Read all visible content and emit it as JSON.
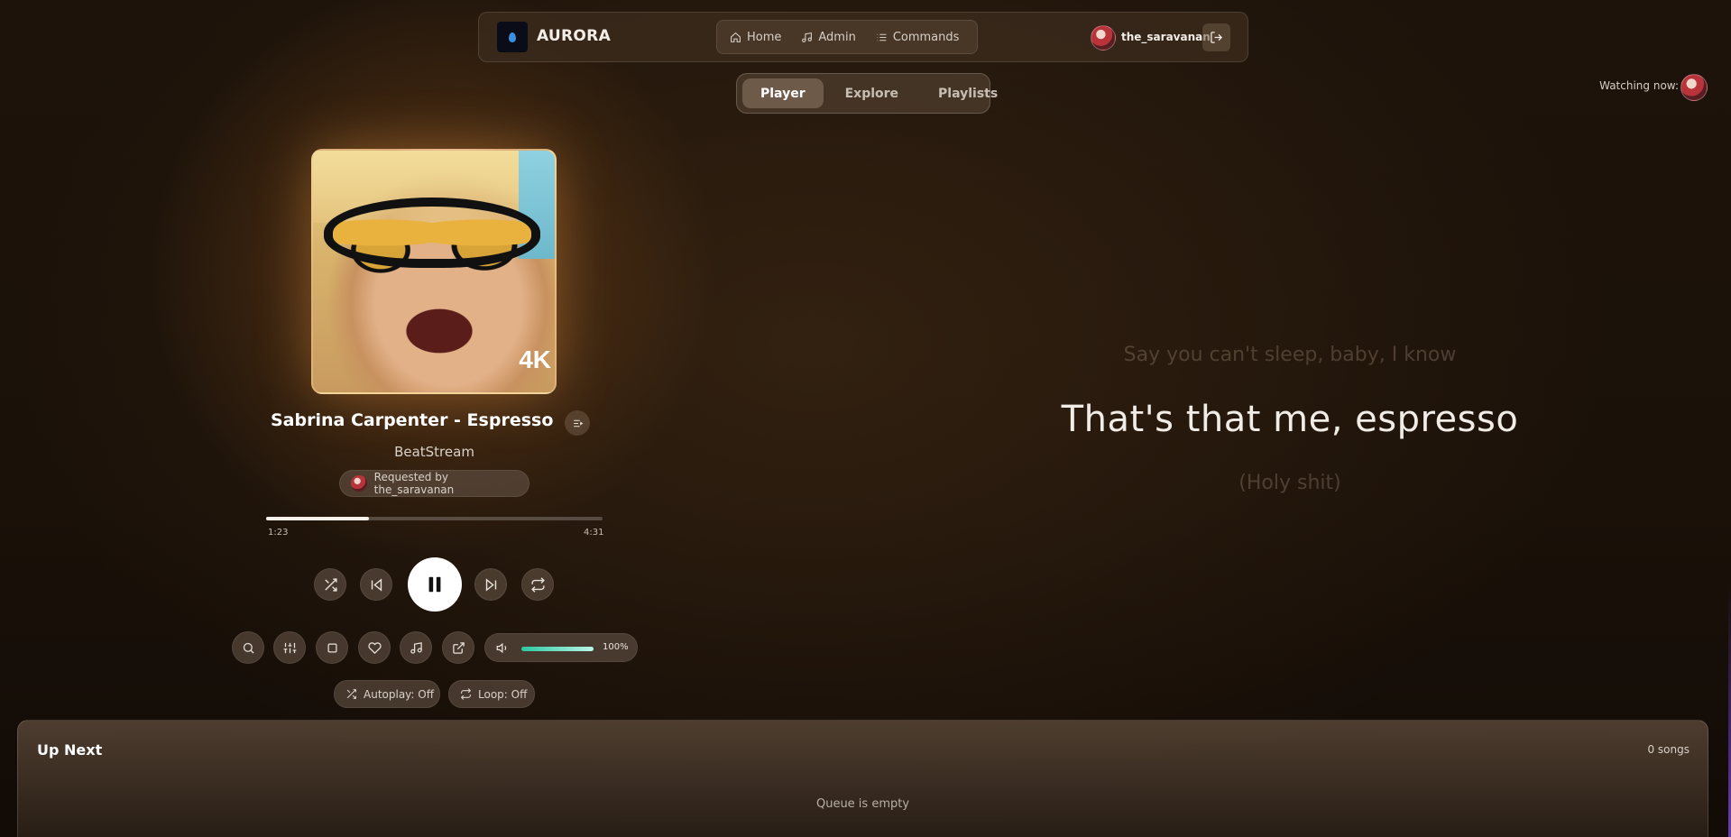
{
  "app": {
    "brand": "AURORA"
  },
  "nav": {
    "links": [
      {
        "label": "Home",
        "icon": "home-icon"
      },
      {
        "label": "Admin",
        "icon": "music-note-icon"
      },
      {
        "label": "Commands",
        "icon": "list-icon"
      }
    ],
    "username": "the_saravanan"
  },
  "tabs": [
    {
      "label": "Player",
      "active": true
    },
    {
      "label": "Explore",
      "active": false
    },
    {
      "label": "Playlists",
      "active": false
    }
  ],
  "watching": {
    "label": "Watching now:"
  },
  "track": {
    "title": "Sabrina Carpenter - Espresso ...",
    "artist": "BeatStream",
    "requested_by": "Requested by the_saravanan",
    "album_badge": "4K",
    "elapsed": "1:23",
    "duration": "4:31",
    "progress_fraction": 0.306
  },
  "volume": {
    "label": "100%",
    "level_fraction": 1.0
  },
  "toggles": {
    "autoplay": "Autoplay: Off",
    "loop": "Loop: Off"
  },
  "lyrics": {
    "previous": "Say you can't sleep, baby, I know",
    "current": "That's that me, espresso",
    "next": "(Holy shit)"
  },
  "queue": {
    "title": "Up Next",
    "count": "0 songs",
    "empty_message": "Queue is empty"
  },
  "colors": {
    "accent_volume": "#2cc7a0",
    "background": "#1a1109"
  }
}
